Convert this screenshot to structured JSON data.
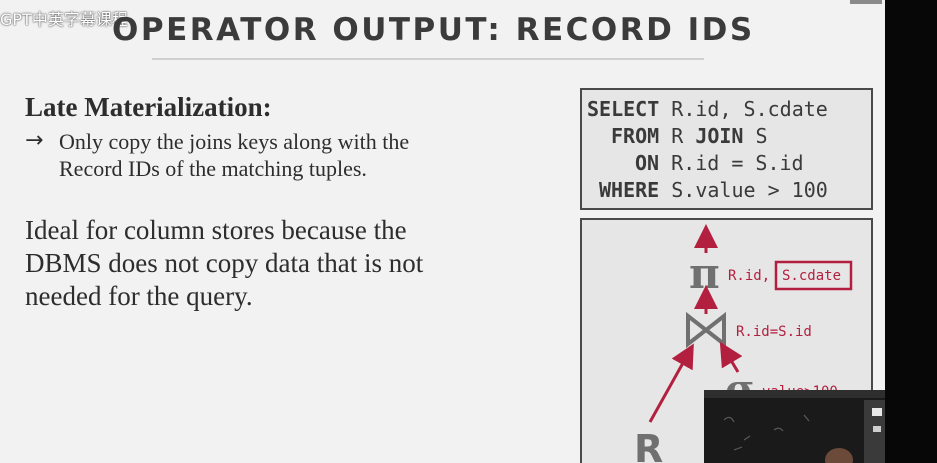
{
  "watermark": "GPT中英字幕课程",
  "slide": {
    "title": "OPERATOR OUTPUT: RECORD IDS",
    "heading": "Late Materialization:",
    "bullet_arrow": "→",
    "bullet_line1": "Only copy the joins keys along with the",
    "bullet_line2": "Record IDs of the matching tuples.",
    "ideal_line1": "Ideal for column stores because the",
    "ideal_line2": "DBMS does not copy data that is not",
    "ideal_line3": "needed for the query."
  },
  "sql": {
    "line1_kw": "SELECT",
    "line1_rest": "R.id, S.cdate",
    "line2_kw": "FROM",
    "line2_rest_a": "R ",
    "line2_join": "JOIN",
    "line2_rest_b": " S",
    "line3_kw": "ON",
    "line3_rest": "R.id = S.id",
    "line4_kw": "WHERE",
    "line4_rest": "S.value > 100"
  },
  "plan": {
    "pi_symbol": "π",
    "pi_label_a": "R.id,",
    "pi_label_b": "S.cdate",
    "join_label": "R.id=S.id",
    "sigma_symbol": "σ",
    "sigma_label": "value>100",
    "r_label": "R",
    "colors": {
      "accent": "#b3203f",
      "symbol": "#707070",
      "box_border": "#4a4a4a"
    }
  }
}
